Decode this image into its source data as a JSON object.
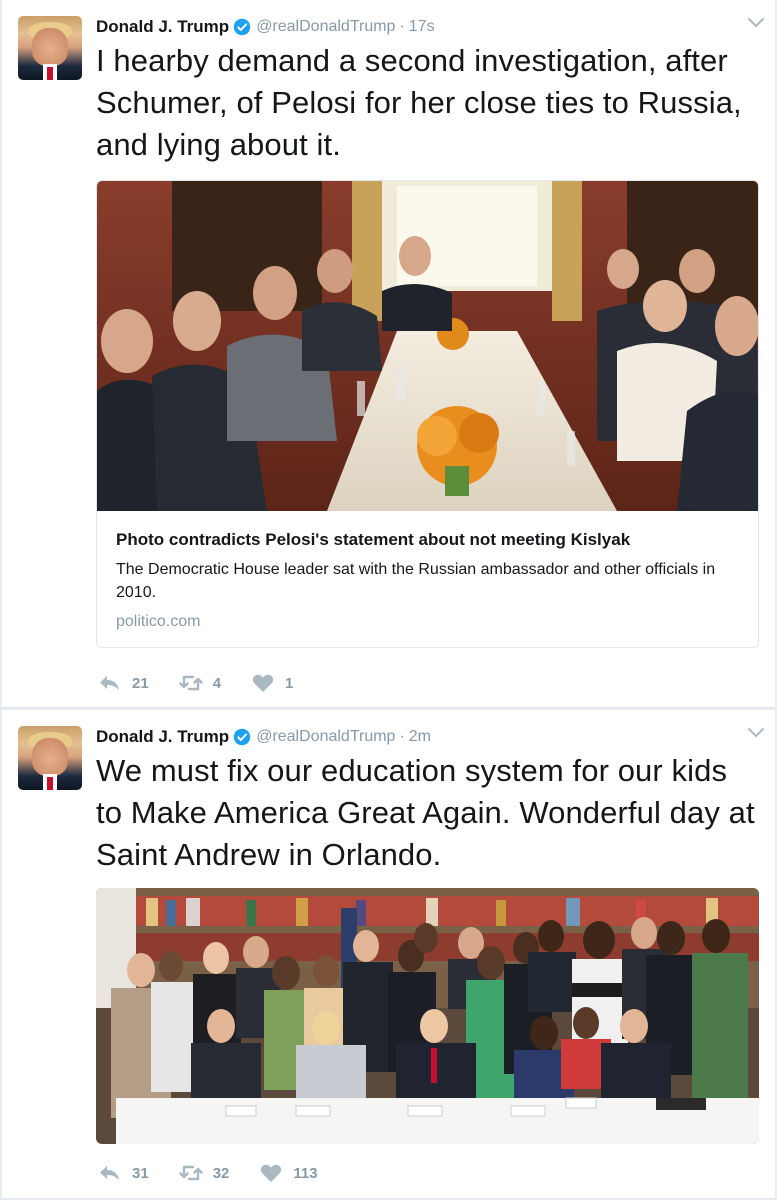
{
  "tweets": [
    {
      "name": "Donald J. Trump",
      "handle": "@realDonaldTrump",
      "separator": "·",
      "time": "17s",
      "text": "I hearby demand a second investigation, after Schumer, of Pelosi for her close ties to Russia, and lying about it.",
      "card": {
        "title": "Photo contradicts Pelosi's statement about not meeting Kislyak",
        "description": "The Democratic House leader sat with the Russian ambassador and other officials in 2010.",
        "domain": "politico.com"
      },
      "actions": {
        "replies": "21",
        "retweets": "4",
        "likes": "1"
      }
    },
    {
      "name": "Donald J. Trump",
      "handle": "@realDonaldTrump",
      "separator": "·",
      "time": "2m",
      "text": "We must fix our education system for our kids to Make America Great Again. Wonderful day at Saint Andrew in Orlando.",
      "actions": {
        "replies": "31",
        "retweets": "32",
        "likes": "113"
      }
    }
  ],
  "colors": {
    "text": "#14171a",
    "secondary": "#8899a6",
    "verified": "#1da1f2",
    "border": "#e1e8ed",
    "background": "#e6ecf0"
  },
  "icons": {
    "verified": "verified-badge-icon",
    "menu": "chevron-down-icon",
    "reply": "reply-icon",
    "retweet": "retweet-icon",
    "like": "heart-icon"
  }
}
